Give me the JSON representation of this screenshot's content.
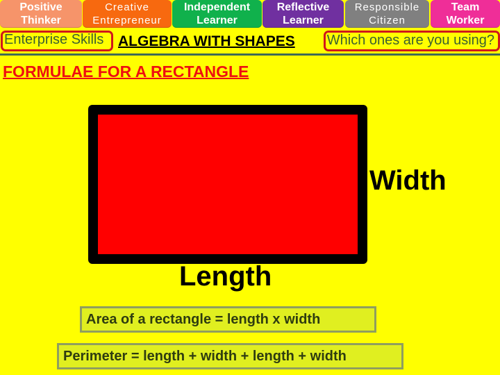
{
  "skills_tabs": [
    {
      "line1": "Positive",
      "line2": "Thinker",
      "color": "#f6946a"
    },
    {
      "line1": "Creative",
      "line2": "Entrepreneur",
      "color": "#f7690f"
    },
    {
      "line1": "Independent",
      "line2": "Learner",
      "color": "#10b14c"
    },
    {
      "line1": "Reflective",
      "line2": "Learner",
      "color": "#7030a0"
    },
    {
      "line1": "Responsible",
      "line2": "Citizen",
      "color": "#808080"
    },
    {
      "line1": "Team",
      "line2": "Worker",
      "color": "#ef2e98"
    }
  ],
  "header": {
    "enterprise_label": "Enterprise Skills",
    "title": "ALGEBRA WITH SHAPES",
    "prompt": "Which ones are you using?"
  },
  "main": {
    "heading": "FORMULAE FOR A RECTANGLE",
    "diagram": {
      "shape": "rectangle",
      "fill_color": "#ff0000",
      "border_color": "#000000",
      "width_label": "Width",
      "length_label": "Length"
    },
    "formulas": {
      "area": "Area of a rectangle = length x width",
      "perimeter": "Perimeter = length + width + length + width"
    }
  },
  "colors": {
    "background": "#ffff00",
    "accent_red": "#ee1010",
    "outline_red": "#d0171c",
    "text_green": "#3b6030"
  }
}
